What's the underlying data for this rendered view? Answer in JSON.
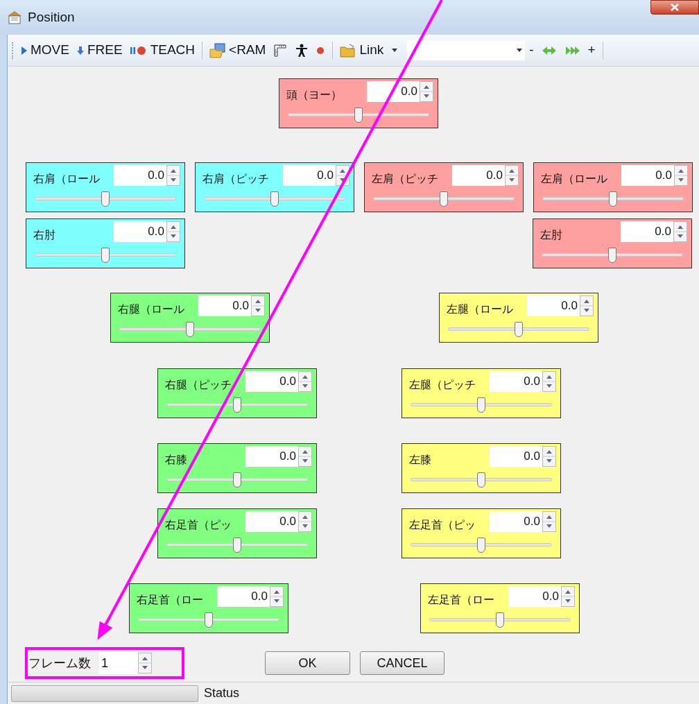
{
  "window": {
    "title": "Position"
  },
  "toolbar": {
    "items": [
      {
        "kind": "icon-text",
        "label": "MOVE"
      },
      {
        "kind": "icon-text",
        "label": "FREE"
      },
      {
        "kind": "icon-text",
        "label": "TEACH"
      },
      {
        "kind": "separator"
      },
      {
        "kind": "icon-text",
        "label": "<RAM"
      },
      {
        "kind": "icon"
      },
      {
        "kind": "icon"
      },
      {
        "kind": "icon"
      },
      {
        "kind": "separator"
      },
      {
        "kind": "dropdown",
        "label": "Link"
      },
      {
        "kind": "combo"
      },
      {
        "kind": "text",
        "label": "-"
      },
      {
        "kind": "icon"
      },
      {
        "kind": "icon"
      },
      {
        "kind": "text",
        "label": "+"
      },
      {
        "kind": "separator"
      }
    ]
  },
  "rows": [
    {
      "panels": [
        {
          "label": "頭（ヨー）",
          "value": "0.0",
          "level": 0.5,
          "color": "#ffa0a0"
        }
      ]
    },
    {
      "panels": [
        {
          "label": "右肩（ロール",
          "value": "0.0",
          "level": 0.5,
          "color": "#80ffff"
        },
        {
          "label": "右肩（ピッチ",
          "value": "0.0",
          "level": 0.5,
          "color": "#80ffff"
        },
        {
          "label": "左肩（ピッチ",
          "value": "0.0",
          "level": 0.5,
          "color": "#ffa0a0"
        },
        {
          "label": "左肩（ロール",
          "value": "0.0",
          "level": 0.5,
          "color": "#ffa0a0"
        }
      ]
    },
    {
      "panels": [
        {
          "label": "右肘",
          "value": "0.0",
          "level": 0.5,
          "color": "#80ffff"
        },
        {
          "label": "左肘",
          "value": "0.0",
          "level": 0.5,
          "color": "#ffa0a0"
        }
      ]
    },
    {
      "panels": [
        {
          "label": "右腿（ロール",
          "value": "0.0",
          "level": 0.5,
          "color": "#80ff80"
        },
        {
          "label": "左腿（ロール",
          "value": "0.0",
          "level": 0.5,
          "color": "#ffff80"
        }
      ]
    },
    {
      "panels": [
        {
          "label": "右腿（ピッチ",
          "value": "0.0",
          "level": 0.5,
          "color": "#80ff80"
        },
        {
          "label": "左腿（ピッチ",
          "value": "0.0",
          "level": 0.5,
          "color": "#ffff80"
        }
      ]
    },
    {
      "panels": [
        {
          "label": "右膝",
          "value": "0.0",
          "level": 0.5,
          "color": "#80ff80"
        },
        {
          "label": "左膝",
          "value": "0.0",
          "level": 0.5,
          "color": "#ffff80"
        }
      ]
    },
    {
      "panels": [
        {
          "label": "右足首（ピッ",
          "value": "0.0",
          "level": 0.5,
          "color": "#80ff80"
        },
        {
          "label": "左足首（ピッ",
          "value": "0.0",
          "level": 0.5,
          "color": "#ffff80"
        }
      ]
    },
    {
      "panels": [
        {
          "label": "右足首（ロー",
          "value": "0.0",
          "level": 0.5,
          "color": "#80ff80"
        },
        {
          "label": "左足首（ロー",
          "value": "0.0",
          "level": 0.5,
          "color": "#ffff80"
        }
      ]
    }
  ],
  "frames": {
    "label": "フレーム数",
    "value": "1"
  },
  "buttons": [
    {
      "label": "OK"
    },
    {
      "label": "CANCEL"
    }
  ],
  "status_bar": {
    "label": "Status",
    "level": 0
  }
}
